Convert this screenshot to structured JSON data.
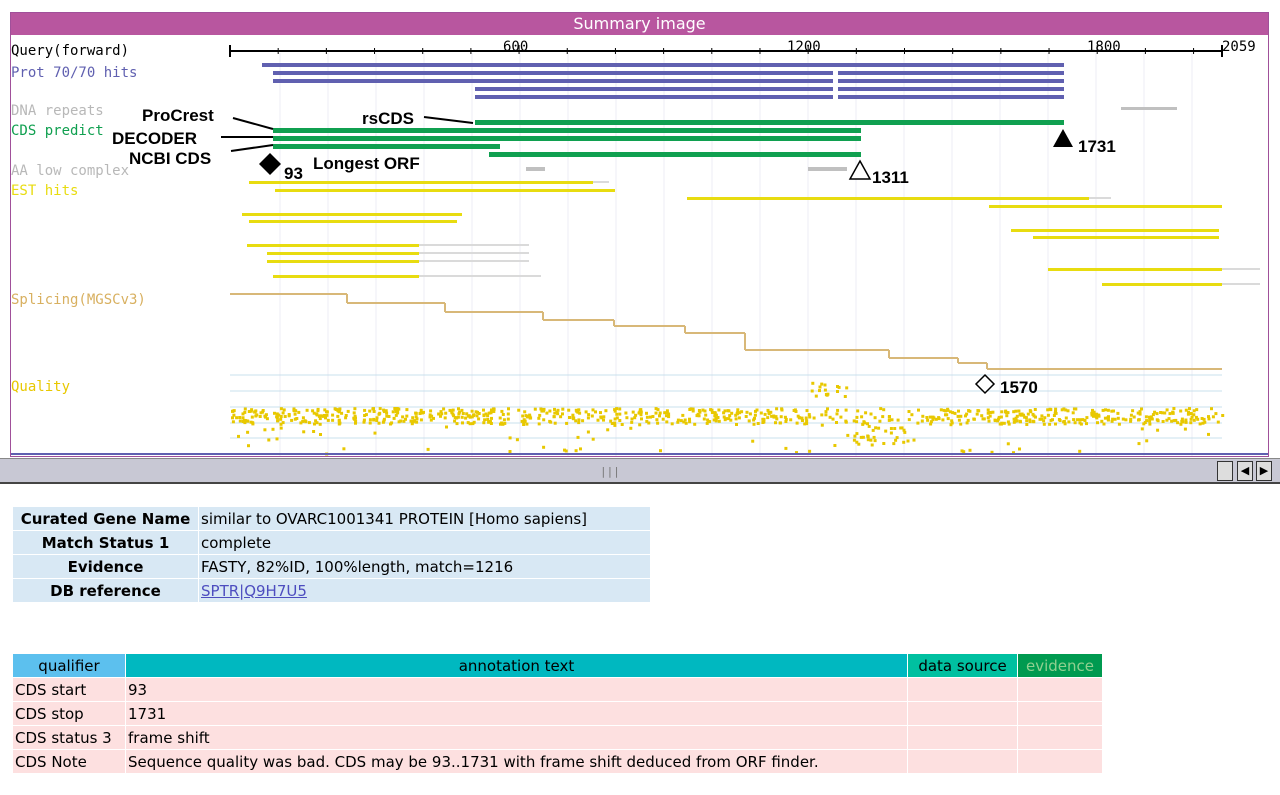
{
  "summary": {
    "title": "Summary image",
    "track_labels": {
      "query": "Query(forward)",
      "prot": "Prot 70/70 hits",
      "dna_repeats": "DNA repeats",
      "cds_predict": "CDS predict",
      "aa_low_complex": "AA low complex",
      "est_hits": "EST hits",
      "splicing": "Splicing(MGSCv3)",
      "quality": "Quality"
    },
    "ticks": [
      {
        "value": 600,
        "label": "600"
      },
      {
        "value": 1200,
        "label": "1200"
      },
      {
        "value": 1800,
        "label": "1800"
      },
      {
        "value": 2059,
        "label": "2059"
      }
    ],
    "annotations": {
      "procrest": "ProCrest",
      "decoder": "DECODER",
      "ncbi_cds": "NCBI CDS",
      "rscds": "rsCDS",
      "longest_orf": "Longest ORF",
      "m93": "93",
      "m1311": "1311",
      "m1731": "1731",
      "m1570": "1570"
    },
    "colors": {
      "header": "#b8569f",
      "prot": "#6060b0",
      "cds": "#10a050",
      "est": "#e8dc10",
      "gray": "#c0c0c0",
      "splicing": "#d8b878",
      "quality_dots": "#e8c800"
    }
  },
  "gene_info": [
    {
      "key": "Curated Gene Name",
      "value": "similar to OVARC1001341 PROTEIN [Homo sapiens]"
    },
    {
      "key": "Match Status 1",
      "value": "complete"
    },
    {
      "key": "Evidence",
      "value": "FASTY, 82%ID, 100%length, match=1216"
    },
    {
      "key": "DB reference",
      "value": "SPTR|Q9H7U5"
    }
  ],
  "qualifiers": {
    "headers": {
      "qualifier": "qualifier",
      "annotation": "annotation text",
      "source": "data source",
      "evidence": "evidence"
    },
    "rows": [
      {
        "qualifier": "CDS start",
        "text": "93",
        "source": "",
        "evidence": ""
      },
      {
        "qualifier": "CDS stop",
        "text": "1731",
        "source": "",
        "evidence": ""
      },
      {
        "qualifier": "CDS status 3",
        "text": "frame shift",
        "source": "",
        "evidence": ""
      },
      {
        "qualifier": "CDS Note",
        "text": "Sequence quality was bad. CDS may be 93..1731 with frame shift deduced from ORF finder.",
        "source": "",
        "evidence": ""
      }
    ]
  }
}
